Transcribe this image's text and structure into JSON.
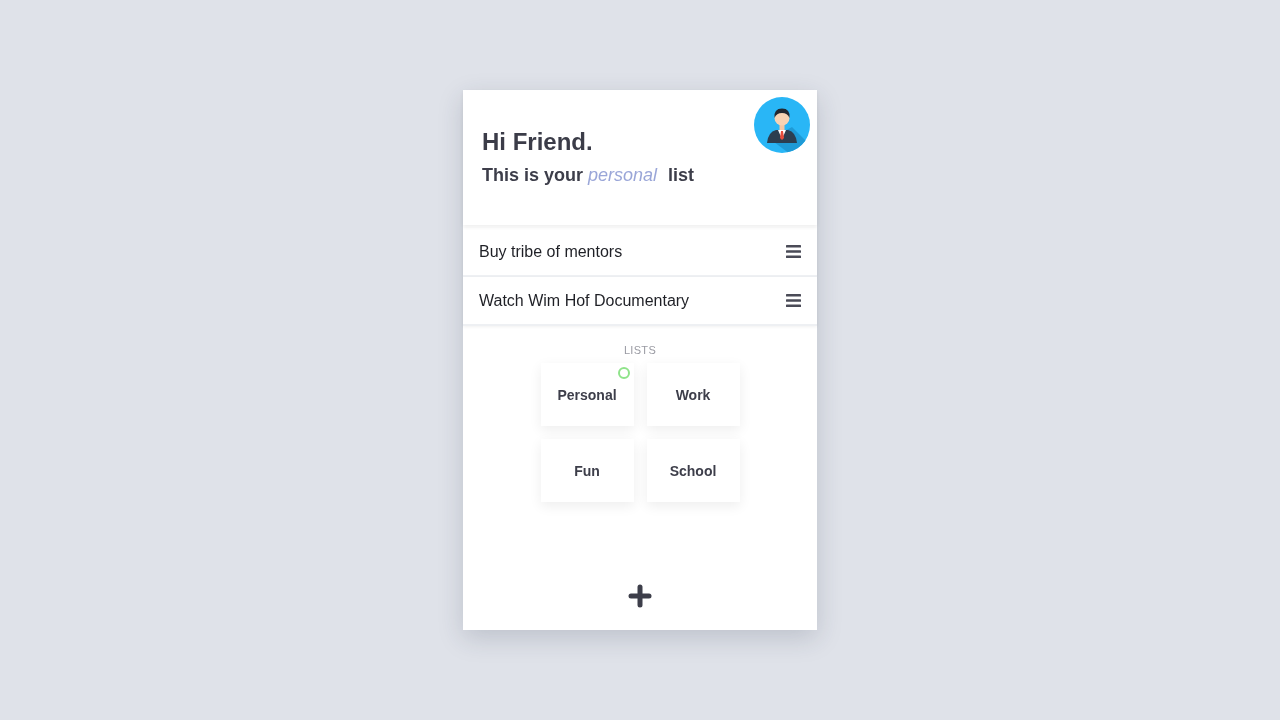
{
  "header": {
    "greeting": "Hi Friend.",
    "subtitle": "This is your *personal* list"
  },
  "tasks": [
    {
      "title": "Buy tribe of mentors"
    },
    {
      "title": "Watch Wim Hof Documentary"
    }
  ],
  "lists_section": {
    "heading": "LISTS",
    "lists": [
      {
        "label": "Personal",
        "selected": true
      },
      {
        "label": "Work",
        "selected": false
      },
      {
        "label": "Fun",
        "selected": false
      },
      {
        "label": "School",
        "selected": false
      }
    ]
  }
}
